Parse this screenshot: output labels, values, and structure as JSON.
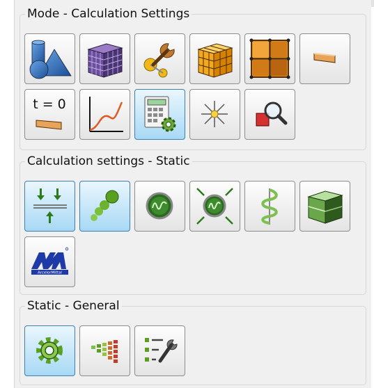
{
  "groups": [
    {
      "title": "Mode - Calculation Settings",
      "buttons": [
        {
          "icon": "geometry-shapes-icon",
          "active": false
        },
        {
          "icon": "mesh-cube-icon",
          "active": false
        },
        {
          "icon": "tools-wrench-icon",
          "active": false
        },
        {
          "icon": "solid-grid-cube-icon",
          "active": false
        },
        {
          "icon": "plate-grid-icon",
          "active": false
        },
        {
          "icon": "beam-element-icon",
          "active": false
        },
        {
          "icon": "initial-state-icon",
          "active": false,
          "text": "t = 0"
        },
        {
          "icon": "curve-graph-icon",
          "active": false
        },
        {
          "icon": "calculator-settings-icon",
          "active": true
        },
        {
          "icon": "burst-star-icon",
          "active": false
        },
        {
          "icon": "inspect-magnifier-icon",
          "active": false
        }
      ]
    },
    {
      "title": "Calculation settings - Static",
      "buttons": [
        {
          "icon": "static-load-arrows-icon",
          "active": true
        },
        {
          "icon": "nonlinear-path-icon",
          "active": true
        },
        {
          "icon": "oscillation-icon",
          "active": false
        },
        {
          "icon": "oscillation-load-icon",
          "active": false
        },
        {
          "icon": "spiral-reinforcement-icon",
          "active": false
        },
        {
          "icon": "green-solid-block-icon",
          "active": false
        },
        {
          "icon": "arcelormittal-logo-icon",
          "active": false,
          "text": "ArcelorMittal"
        }
      ]
    },
    {
      "title": "Static - General",
      "buttons": [
        {
          "icon": "gear-icon",
          "active": true
        },
        {
          "icon": "color-bars-icon",
          "active": false
        },
        {
          "icon": "checklist-wrench-icon",
          "active": false
        }
      ]
    }
  ]
}
